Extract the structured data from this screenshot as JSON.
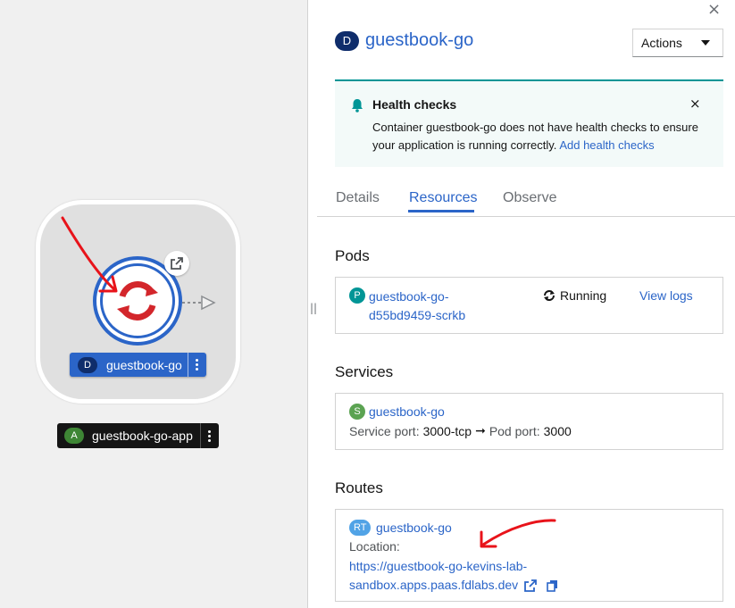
{
  "topology": {
    "node_badge": "D",
    "node_name": "guestbook-go",
    "app_badge": "A",
    "app_name": "guestbook-go-app",
    "divider_glyph": "||"
  },
  "panel": {
    "close_glyph": "×",
    "resource_badge": "D",
    "resource_name": "guestbook-go",
    "actions_label": "Actions",
    "alert": {
      "title": "Health checks",
      "close_glyph": "×",
      "body": "Container guestbook-go does not have health checks to ensure your application is running correctly.",
      "link": "Add health checks"
    },
    "tabs": [
      "Details",
      "Resources",
      "Observe"
    ],
    "active_tab": "Resources",
    "pods": {
      "title": "Pods",
      "badge": "P",
      "name_line1": "guestbook-go-",
      "name_line2": "d55bd9459-scrkb",
      "status": "Running",
      "view_logs": "View logs"
    },
    "services": {
      "title": "Services",
      "badge": "S",
      "name": "guestbook-go",
      "port_label": "Service port:",
      "port_value": "3000-tcp",
      "arrow": "➞",
      "pod_port_label": "Pod port:",
      "pod_port_value": "3000"
    },
    "routes": {
      "title": "Routes",
      "badge": "RT",
      "name": "guestbook-go",
      "location_label": "Location:",
      "url_line1": "https://guestbook-go-kevins-lab-",
      "url_line2": "sandbox.apps.paas.fdlabs.dev"
    }
  },
  "colors": {
    "accent": "#2b65c8",
    "annotation_red": "#e8131a",
    "alert_teal": "#009596"
  }
}
